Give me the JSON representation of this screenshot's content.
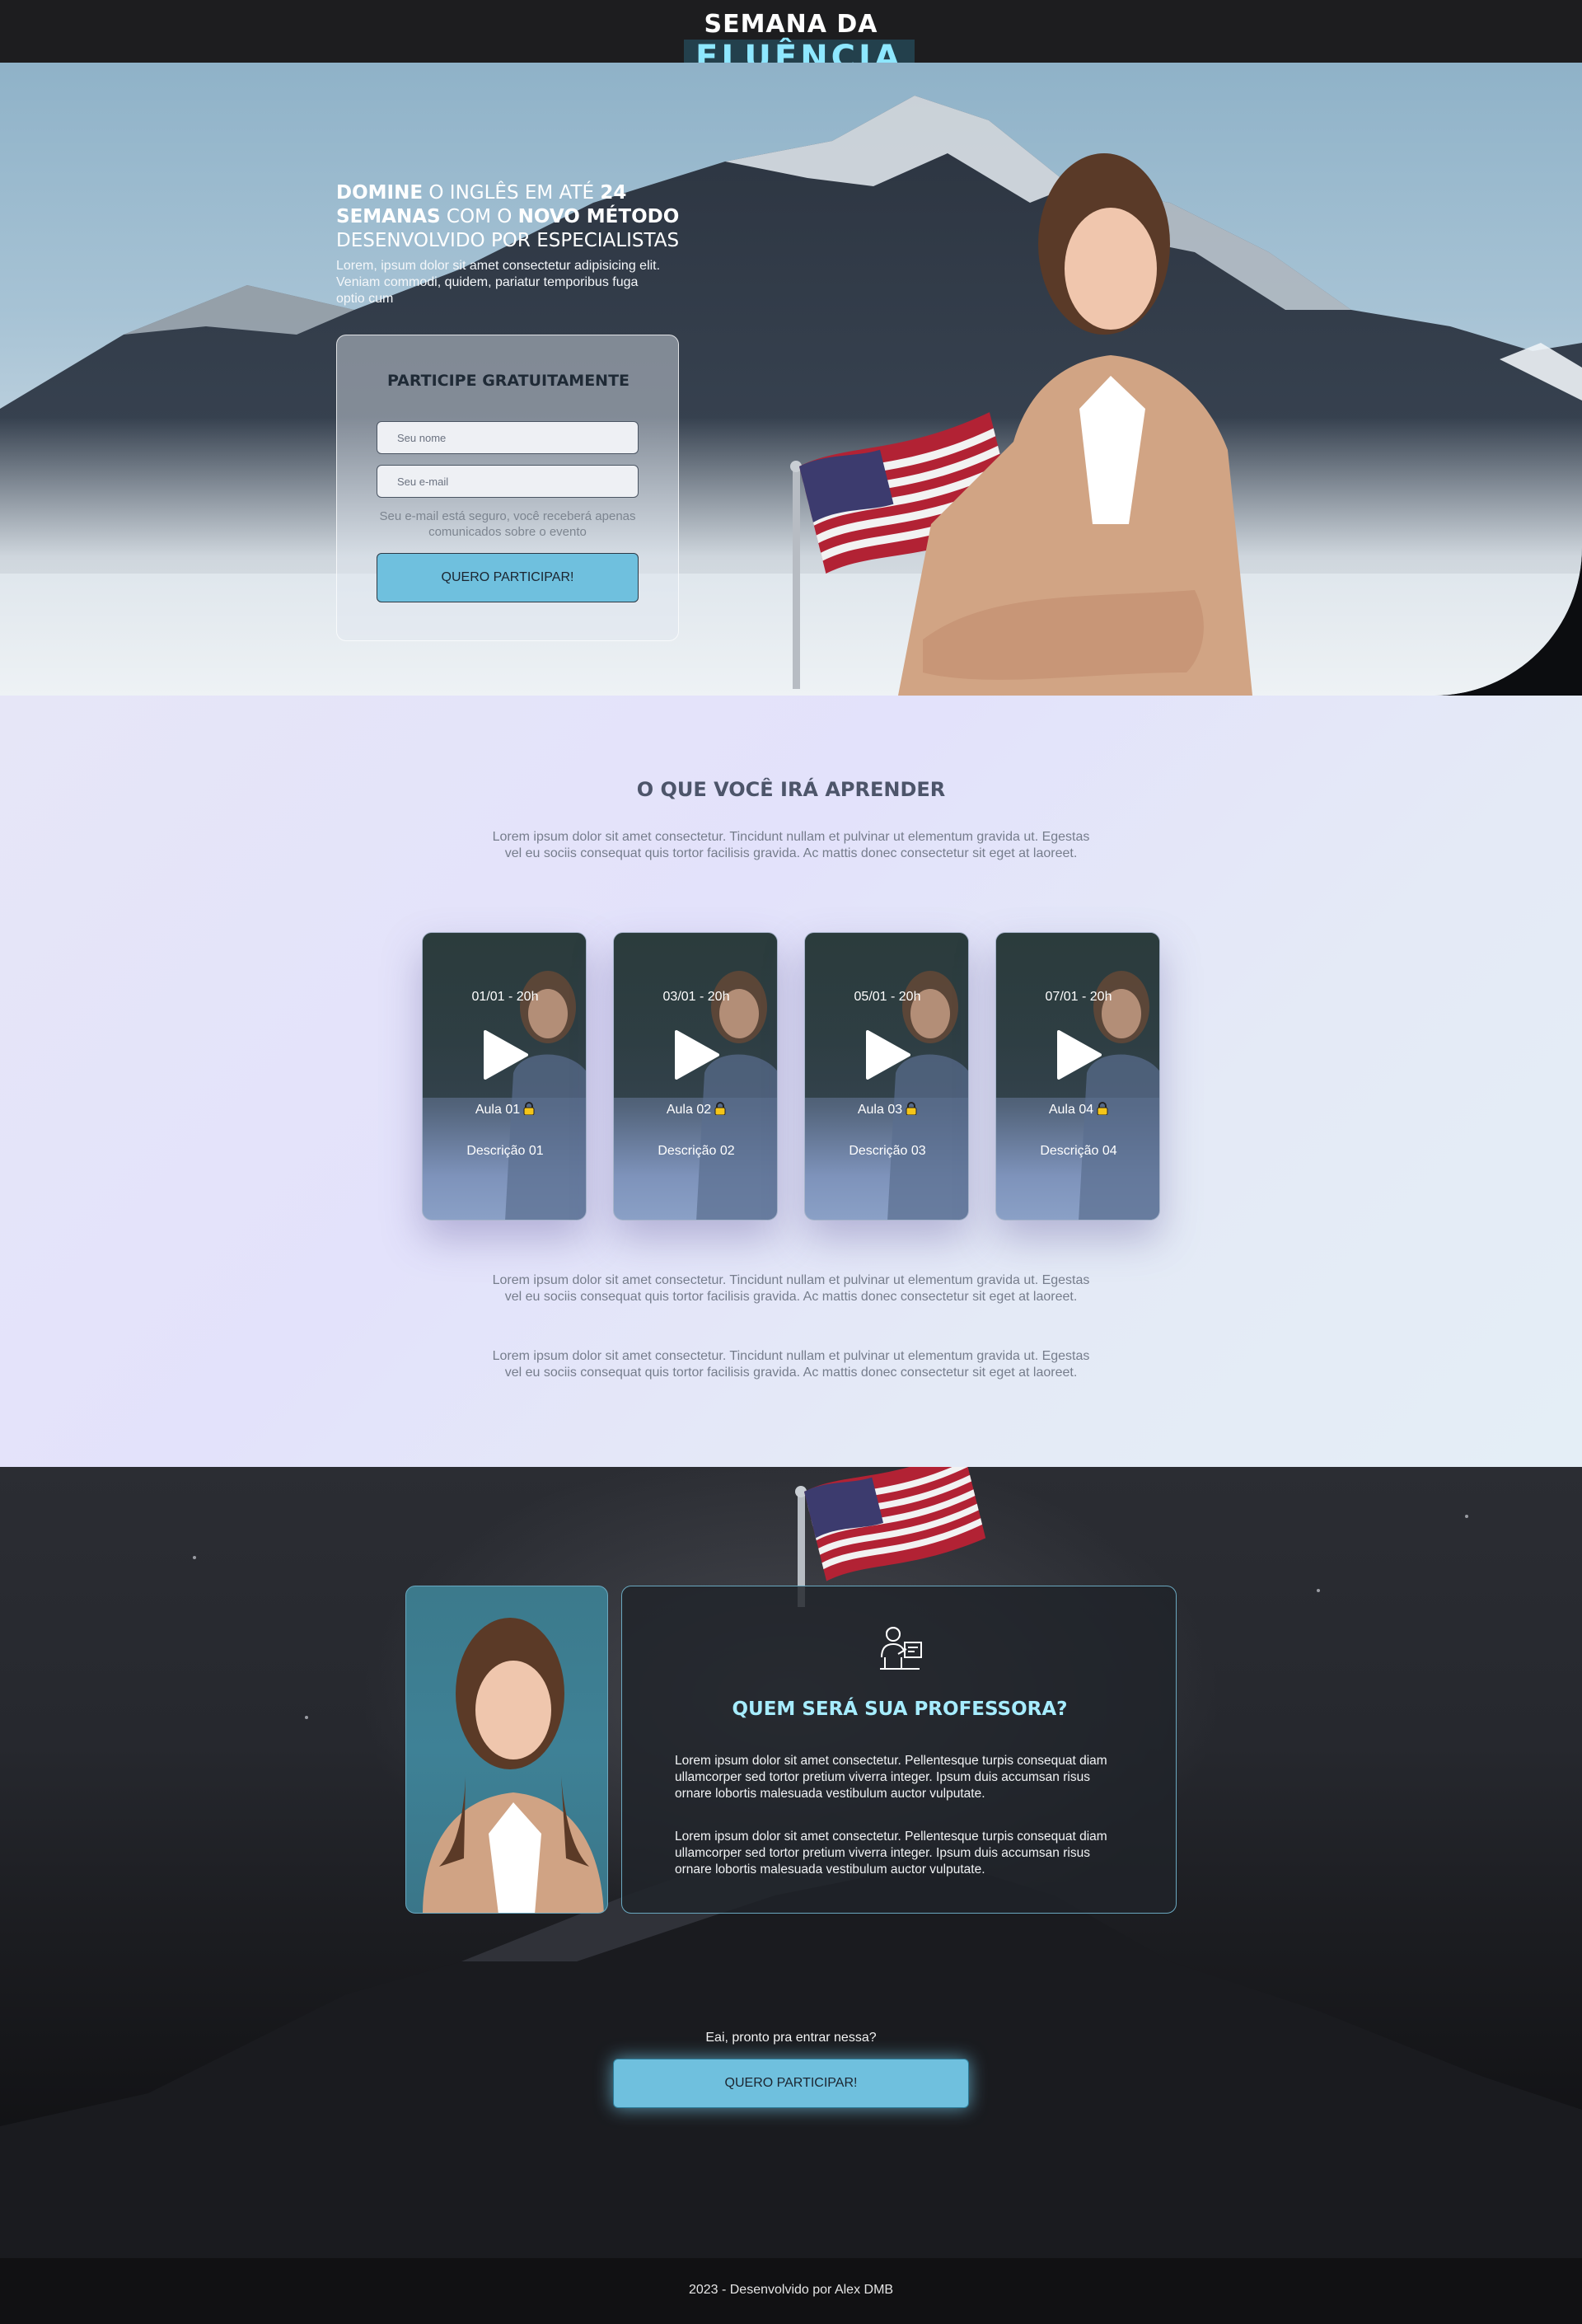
{
  "brand": {
    "logo_line1": "SEMANA DA",
    "logo_line2": "FLUÊNCIA"
  },
  "hero": {
    "title_parts": [
      "DOMINE",
      " O INGLÊS EM ATÉ ",
      "24 SEMANAS",
      " COM O ",
      "NOVO MÉTODO",
      " DESENVOLVIDO POR ESPECIALISTAS"
    ],
    "subtitle": "Lorem, ipsum dolor sit amet consectetur adipisicing elit. Veniam commodi, quidem, pariatur temporibus fuga optio cum",
    "form": {
      "title": "PARTICIPE GRATUITAMENTE",
      "name_placeholder": "Seu nome",
      "email_placeholder": "Seu e-mail",
      "note": "Seu e-mail está seguro, você receberá apenas comunicados sobre o evento",
      "button": "QUERO PARTICIPAR!"
    }
  },
  "learn": {
    "title": "O QUE VOCÊ IRÁ APRENDER",
    "paragraph1": "Lorem ipsum dolor sit amet consectetur. Tincidunt nullam et pulvinar ut elementum gravida ut. Egestas vel eu sociis consequat quis tortor facilisis gravida. Ac mattis donec consectetur sit eget at laoreet.",
    "paragraph2": "Lorem ipsum dolor sit amet consectetur. Tincidunt nullam et pulvinar ut elementum gravida ut. Egestas vel eu sociis consequat quis tortor facilisis gravida. Ac mattis donec consectetur sit eget at laoreet.",
    "paragraph3": "Lorem ipsum dolor sit amet consectetur. Tincidunt nullam et pulvinar ut elementum gravida ut. Egestas vel eu sociis consequat quis tortor facilisis gravida. Ac mattis donec consectetur sit eget at laoreet.",
    "lessons": [
      {
        "date": "01/01 - 20h",
        "title": "Aula 01",
        "description": "Descrição 01"
      },
      {
        "date": "03/01 - 20h",
        "title": "Aula 02",
        "description": "Descrição 02"
      },
      {
        "date": "05/01 - 20h",
        "title": "Aula 03",
        "description": "Descrição 03"
      },
      {
        "date": "07/01 - 20h",
        "title": "Aula 04",
        "description": "Descrição 04"
      }
    ]
  },
  "professor": {
    "title": "QUEM SERÁ SUA PROFESSORA?",
    "paragraph1": "Lorem ipsum dolor sit amet consectetur. Pellentesque turpis consequat diam ullamcorper sed tortor pretium viverra integer. Ipsum duis accumsan risus ornare lobortis malesuada vestibulum auctor vulputate.",
    "paragraph2": "Lorem ipsum dolor sit amet consectetur. Pellentesque turpis consequat diam ullamcorper sed tortor pretium viverra integer. Ipsum duis accumsan risus ornare lobortis malesuada vestibulum auctor vulputate."
  },
  "cta": {
    "question": "Eai, pronto pra entrar nessa?",
    "button": "QUERO PARTICIPAR!"
  },
  "footer": {
    "text": "2023 - Desenvolvido por Alex DMB"
  },
  "colors": {
    "accent": "#6fc0de",
    "logo_highlight": "#8ee7ff",
    "teacher_title": "#a6ecff"
  },
  "icons": [
    "play-icon",
    "lock-icon",
    "teacher-icon",
    "us-flag"
  ]
}
